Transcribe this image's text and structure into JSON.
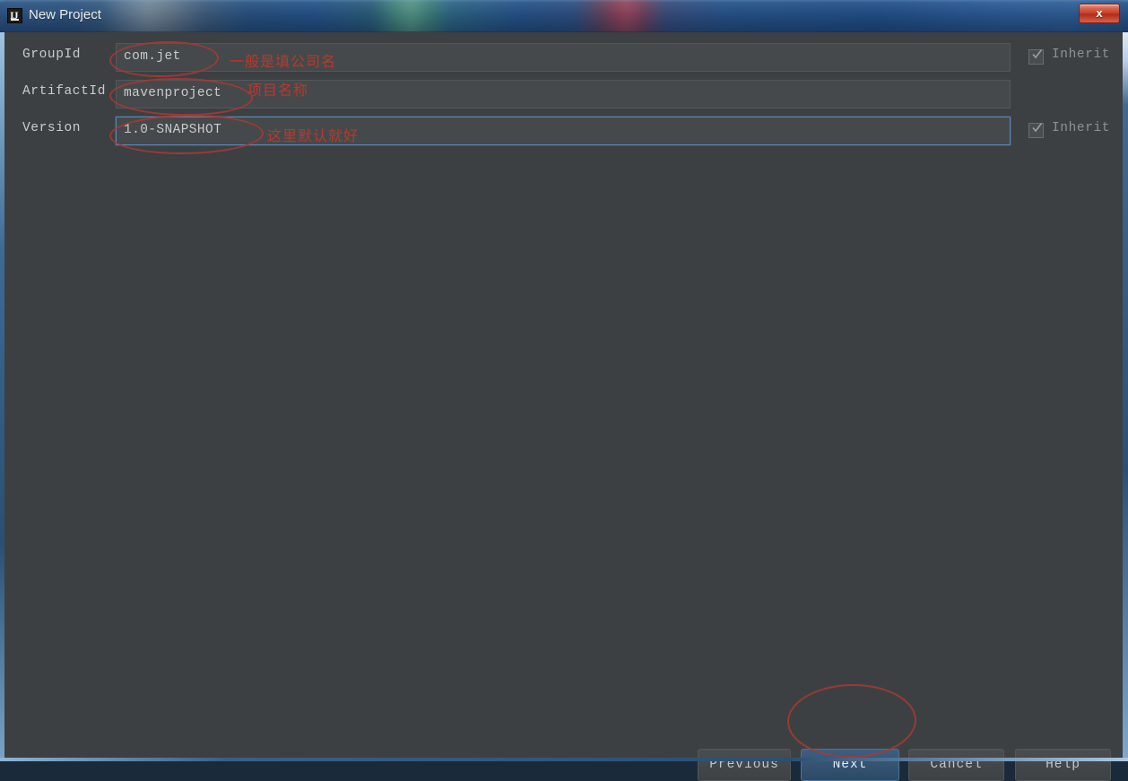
{
  "window": {
    "title": "New Project",
    "app_icon": "intellij-idea-icon",
    "close_label": "x"
  },
  "form": {
    "rows": [
      {
        "label": "GroupId",
        "value": "com.jet",
        "inherit_label": "Inherit",
        "inherit_checked": true,
        "focused": false,
        "annotation": "一般是填公司名"
      },
      {
        "label": "ArtifactId",
        "value": "mavenproject",
        "inherit_label": "",
        "inherit_checked": false,
        "focused": false,
        "annotation": "项目名称"
      },
      {
        "label": "Version",
        "value": "1.0-SNAPSHOT",
        "inherit_label": "Inherit",
        "inherit_checked": true,
        "focused": true,
        "annotation": "这里默认就好"
      }
    ]
  },
  "buttons": {
    "previous": "Previous",
    "next": "Next",
    "cancel": "Cancel",
    "help": "Help"
  },
  "colors": {
    "dialog_background": "#3c4043",
    "field_background": "#45494b",
    "focus_border": "#5b87b5",
    "default_button": "#355573",
    "annotation_red": "#c0392b",
    "titlebar_blue": "#23538a"
  }
}
